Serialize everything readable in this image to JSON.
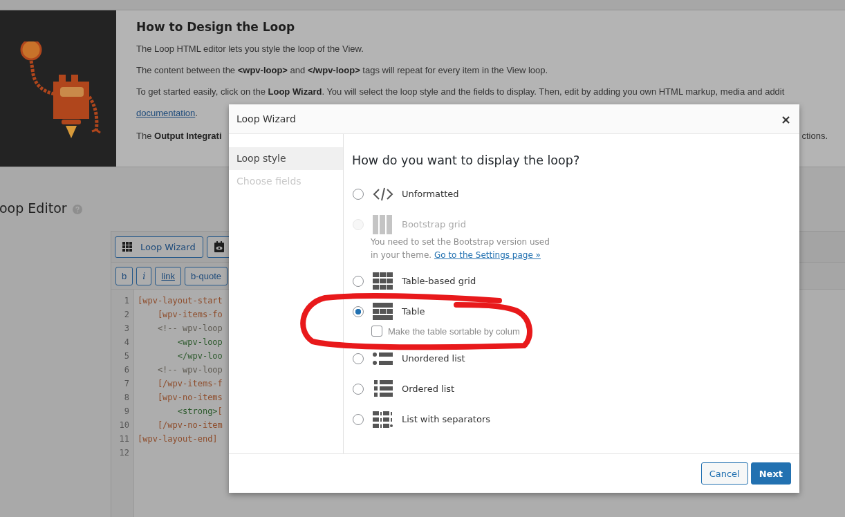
{
  "help": {
    "title": "How to Design the Loop",
    "paragraphs": [
      {
        "kind": "text",
        "text": "The Loop HTML editor lets you style the loop of the View."
      },
      {
        "kind": "text",
        "text": "The content between the **<wpv-loop>** and **</wpv-loop>** tags will repeat for every item in the View loop."
      },
      {
        "kind": "text",
        "text": "To get started easily, click on the **Loop Wizard**. You will select the loop style and the fields to display. Then, edit by adding you own HTML markup, media and addit"
      },
      {
        "kind": "link",
        "link": "documentation",
        "after": "."
      },
      {
        "kind": "split",
        "left": "The **Output Integrati**",
        "right": "ctions."
      }
    ]
  },
  "editor": {
    "title": "oop Editor",
    "toolbar": [
      {
        "kind": "wizard",
        "label": "Loop Wizard"
      },
      {
        "kind": "preview"
      }
    ],
    "quicktags": [
      {
        "kind": "plain",
        "label": "b"
      },
      {
        "kind": "italic",
        "label": "i"
      },
      {
        "kind": "link",
        "label": "link"
      },
      {
        "kind": "plain",
        "label": "b-quote"
      }
    ],
    "lines": [
      {
        "number": "1",
        "parts": [
          {
            "kind": "shortcode",
            "text": "[wpv-layout-start"
          }
        ]
      },
      {
        "number": "2",
        "parts": [
          {
            "kind": "shortcode",
            "text": "    [wpv-items-fo"
          }
        ]
      },
      {
        "number": "3",
        "parts": [
          {
            "kind": "comment",
            "text": "    <!-- wpv-loop"
          }
        ]
      },
      {
        "number": "4",
        "parts": [
          {
            "kind": "tag",
            "text": "        <wpv-loop"
          }
        ]
      },
      {
        "number": "5",
        "parts": [
          {
            "kind": "tag",
            "text": "        </wpv-loo"
          }
        ]
      },
      {
        "number": "6",
        "parts": [
          {
            "kind": "comment",
            "text": "    <!-- wpv-loop"
          }
        ]
      },
      {
        "number": "7",
        "parts": [
          {
            "kind": "shortcode",
            "text": "    [/wpv-items-f"
          }
        ]
      },
      {
        "number": "8",
        "parts": [
          {
            "kind": "shortcode",
            "text": "    [wpv-no-items"
          }
        ]
      },
      {
        "number": "9",
        "parts": [
          {
            "kind": "tag",
            "text": "        <strong>"
          },
          {
            "kind": "shortcode",
            "text": "["
          }
        ]
      },
      {
        "number": "10",
        "parts": [
          {
            "kind": "shortcode",
            "text": "    [/wpv-no-item"
          }
        ]
      },
      {
        "number": "11",
        "parts": [
          {
            "kind": "shortcode",
            "text": "[wpv-layout-end]"
          }
        ]
      },
      {
        "number": "12"
      }
    ]
  },
  "modal": {
    "title": "Loop Wizard",
    "close": "×",
    "nav": [
      {
        "label": "Loop style",
        "selected": true,
        "disabled": false
      },
      {
        "label": "Choose fields",
        "selected": false,
        "disabled": true
      }
    ],
    "heading": "How do you want to display the loop?",
    "options": [
      {
        "kind": "unformatted",
        "label": "Unformatted",
        "selected": false,
        "disabled": false
      },
      {
        "kind": "bootstrap",
        "label": "Bootstrap grid",
        "selected": false,
        "disabled": true,
        "note": "You need to set the Bootstrap version used in your theme.",
        "note_link": "Go to the Settings page »"
      },
      {
        "kind": "table_grid",
        "label": "Table-based grid",
        "selected": false,
        "disabled": false
      },
      {
        "kind": "table",
        "label": "Table",
        "selected": true,
        "disabled": false,
        "checkbox": {
          "label": "Make the table sortable by colum",
          "checked": false
        }
      },
      {
        "kind": "unordered",
        "label": "Unordered list",
        "selected": false,
        "disabled": false
      },
      {
        "kind": "ordered",
        "label": "Ordered list",
        "selected": false,
        "disabled": false
      },
      {
        "kind": "separators",
        "label": "List with separators",
        "selected": false,
        "disabled": false
      }
    ],
    "buttons": [
      {
        "kind": "secondary",
        "label": "Cancel"
      },
      {
        "kind": "primary",
        "label": "Next"
      }
    ]
  }
}
